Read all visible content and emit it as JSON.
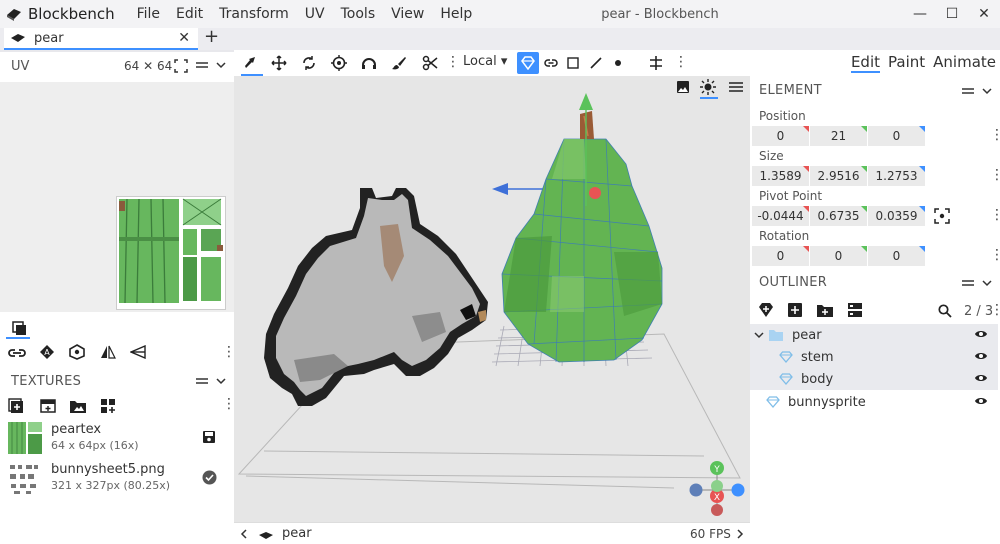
{
  "app": {
    "name": "Blockbench",
    "window_title": "pear - Blockbench"
  },
  "menu": [
    "File",
    "Edit",
    "Transform",
    "UV",
    "Tools",
    "View",
    "Help"
  ],
  "window_controls": {
    "minimize": "—",
    "maximize": "☐",
    "close": "✕"
  },
  "tab": {
    "label": "pear",
    "close": "✕",
    "add": "+"
  },
  "uv_panel": {
    "title": "UV",
    "size": "64 ✕ 64"
  },
  "toolbar": {
    "space": "Local ▾"
  },
  "textures": {
    "title": "TEXTURES",
    "items": [
      {
        "name": "peartex",
        "info": "64 x 64px (16x)"
      },
      {
        "name": "bunnysheet5.png",
        "info": "321 x 327px (80.25x)"
      }
    ]
  },
  "mode_tabs": [
    "Edit",
    "Paint",
    "Animate"
  ],
  "element": {
    "title": "ELEMENT",
    "position": {
      "label": "Position",
      "values": [
        "0",
        "21",
        "0"
      ]
    },
    "size": {
      "label": "Size",
      "values": [
        "1.3589",
        "2.9516",
        "1.2753"
      ]
    },
    "pivot": {
      "label": "Pivot Point",
      "values": [
        "-0.0444",
        "0.6735",
        "0.0359"
      ]
    },
    "rotation": {
      "label": "Rotation",
      "values": [
        "0",
        "0",
        "0"
      ]
    }
  },
  "outliner": {
    "title": "OUTLINER",
    "count": "2 / 3",
    "items": [
      {
        "name": "pear"
      },
      {
        "name": "stem"
      },
      {
        "name": "body"
      },
      {
        "name": "bunnysprite"
      }
    ]
  },
  "gizmo": {
    "y": "Y",
    "x": "X"
  },
  "status": {
    "name": "pear",
    "fps": "60 FPS"
  },
  "colors": {
    "accent": "#3e90ff",
    "axis_x": "#e85454",
    "axis_y": "#5bc25b",
    "axis_z": "#3e90ff"
  }
}
